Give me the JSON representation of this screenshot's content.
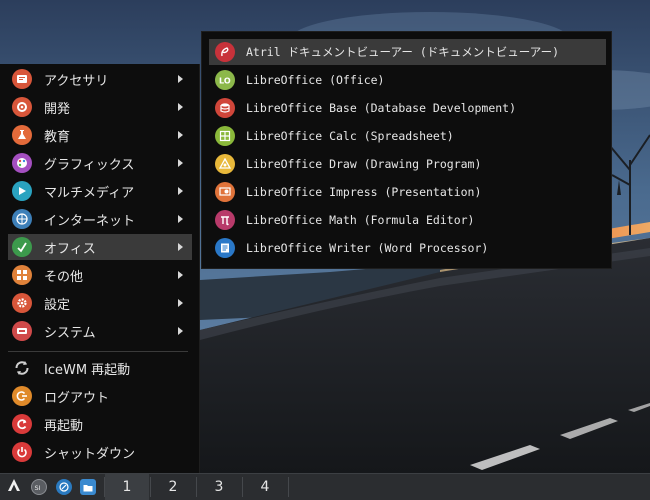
{
  "main_menu": {
    "items": [
      {
        "label": "アクセサリ",
        "icon": "accessories-icon",
        "submenu": true
      },
      {
        "label": "開発",
        "icon": "development-icon",
        "submenu": true
      },
      {
        "label": "教育",
        "icon": "education-icon",
        "submenu": true
      },
      {
        "label": "グラフィックス",
        "icon": "graphics-icon",
        "submenu": true
      },
      {
        "label": "マルチメディア",
        "icon": "multimedia-icon",
        "submenu": true
      },
      {
        "label": "インターネット",
        "icon": "internet-icon",
        "submenu": true
      },
      {
        "label": "オフィス",
        "icon": "office-icon",
        "submenu": true,
        "active": true
      },
      {
        "label": "その他",
        "icon": "other-icon",
        "submenu": true
      },
      {
        "label": "設定",
        "icon": "settings-icon",
        "submenu": true
      },
      {
        "label": "システム",
        "icon": "system-icon",
        "submenu": true
      }
    ],
    "actions": [
      {
        "label": "IceWM 再起動",
        "icon": "restart-wm-icon"
      },
      {
        "label": "ログアウト",
        "icon": "logout-icon"
      },
      {
        "label": "再起動",
        "icon": "reboot-icon"
      },
      {
        "label": "シャットダウン",
        "icon": "shutdown-icon"
      }
    ]
  },
  "office_submenu": {
    "items": [
      {
        "label": "Atril ドキュメントビューアー (ドキュメントビューアー)",
        "icon": "atril-icon",
        "active": true
      },
      {
        "label": "LibreOffice (Office)",
        "icon": "libreoffice-icon"
      },
      {
        "label": "LibreOffice Base (Database Development)",
        "icon": "libreoffice-base-icon"
      },
      {
        "label": "LibreOffice Calc (Spreadsheet)",
        "icon": "libreoffice-calc-icon"
      },
      {
        "label": "LibreOffice Draw (Drawing Program)",
        "icon": "libreoffice-draw-icon"
      },
      {
        "label": "LibreOffice Impress (Presentation)",
        "icon": "libreoffice-impress-icon"
      },
      {
        "label": "LibreOffice Math (Formula Editor)",
        "icon": "libreoffice-math-icon"
      },
      {
        "label": "LibreOffice Writer (Word Processor)",
        "icon": "libreoffice-writer-icon"
      }
    ]
  },
  "taskbar": {
    "start_icon": "antix-start-icon",
    "tray_icons": [
      "show-desktop-icon",
      "browser-icon",
      "file-manager-icon"
    ],
    "workspaces": [
      "1",
      "2",
      "3",
      "4"
    ],
    "active_workspace": "1"
  },
  "colors": {
    "menu_bg": "#0d0d0d",
    "menu_highlight": "#3a3a3a",
    "taskbar_bg": "#2b2d30"
  }
}
